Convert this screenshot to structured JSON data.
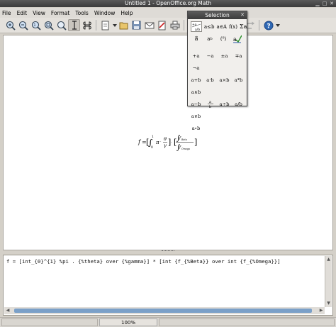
{
  "window": {
    "title": "Untitled 1 - OpenOffice.org Math"
  },
  "menu": {
    "items": [
      "File",
      "Edit",
      "View",
      "Format",
      "Tools",
      "Window",
      "Help"
    ]
  },
  "toolbar": {
    "icons": [
      "zoom-in-icon",
      "zoom-out-icon",
      "zoom-100-icon",
      "show-all-icon",
      "update-icon",
      "formula-cursor-icon",
      "symbols-icon",
      "new-icon",
      "open-icon",
      "save-icon",
      "mail-icon",
      "export-pdf-icon",
      "print-icon",
      "cut-icon",
      "copy-icon",
      "paste-icon",
      "undo-icon",
      "redo-icon",
      "help-icon"
    ]
  },
  "command": {
    "text": "f = [int_{0}^{1} %pi . {%theta} over {%gamma}] * [int {f_{%Beta}} over int {f_{%Omega}}]"
  },
  "status": {
    "zoom": "100%"
  },
  "selection_panel": {
    "title": "Selection",
    "categories": [
      "a+b a·b",
      "a≤b",
      "a∈A",
      "f(x)",
      "Σa",
      "⃗a",
      "a^b",
      "( )",
      "check"
    ],
    "symbols": [
      [
        "+a",
        "−a",
        "±a",
        "∓a",
        "¬a"
      ],
      [
        "a+b",
        "a·b",
        "a×b",
        "a*b",
        "a∧b"
      ],
      [
        "a−b",
        "a/b",
        "a÷b",
        "a/b",
        "a∨b"
      ],
      [
        "a∘b"
      ]
    ]
  },
  "formula": {
    "lhs": "f",
    "pi": "π",
    "theta": "θ",
    "gamma": "γ",
    "beta_sub": "Beta",
    "omega_sub": "Omega",
    "lower": "0",
    "upper": "1"
  },
  "colors": {
    "title_bg": "#3b3b3b",
    "chrome": "#d4d0c8",
    "scroll_thumb": "#7ba0c8"
  }
}
